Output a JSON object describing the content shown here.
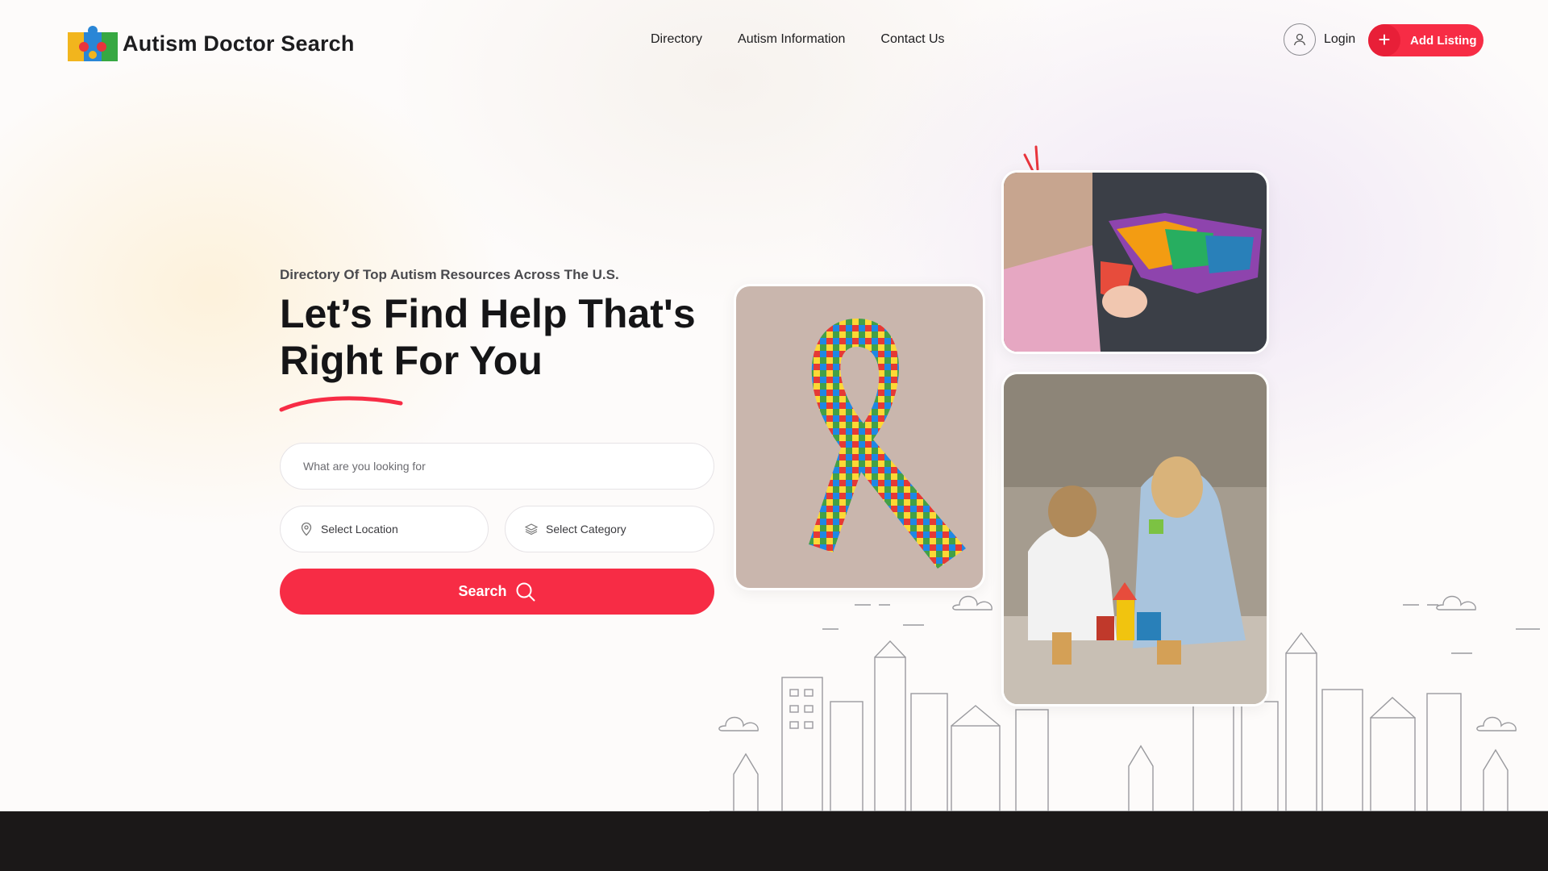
{
  "header": {
    "logo_text": "Autism Doctor Search",
    "nav": [
      "Directory",
      "Autism Information",
      "Contact Us"
    ],
    "login_label": "Login",
    "add_listing_label": "Add Listing"
  },
  "hero": {
    "eyebrow": "Directory Of Top Autism Resources Across The U.S.",
    "headline_line1": "Let’s Find Help That's",
    "headline_line2": "Right For You",
    "search": {
      "keyword_placeholder": "What are you looking for",
      "location_label": "Select Location",
      "category_label": "Select Category",
      "button_label": "Search"
    }
  },
  "icons": {
    "logo": "puzzle-logo-icon",
    "user": "user-icon",
    "plus": "plus-icon",
    "location": "location-pin-icon",
    "category": "layers-icon",
    "search": "search-icon"
  },
  "colors": {
    "accent": "#f72c45",
    "footer": "#1b1818",
    "text": "#1d1d1f"
  }
}
